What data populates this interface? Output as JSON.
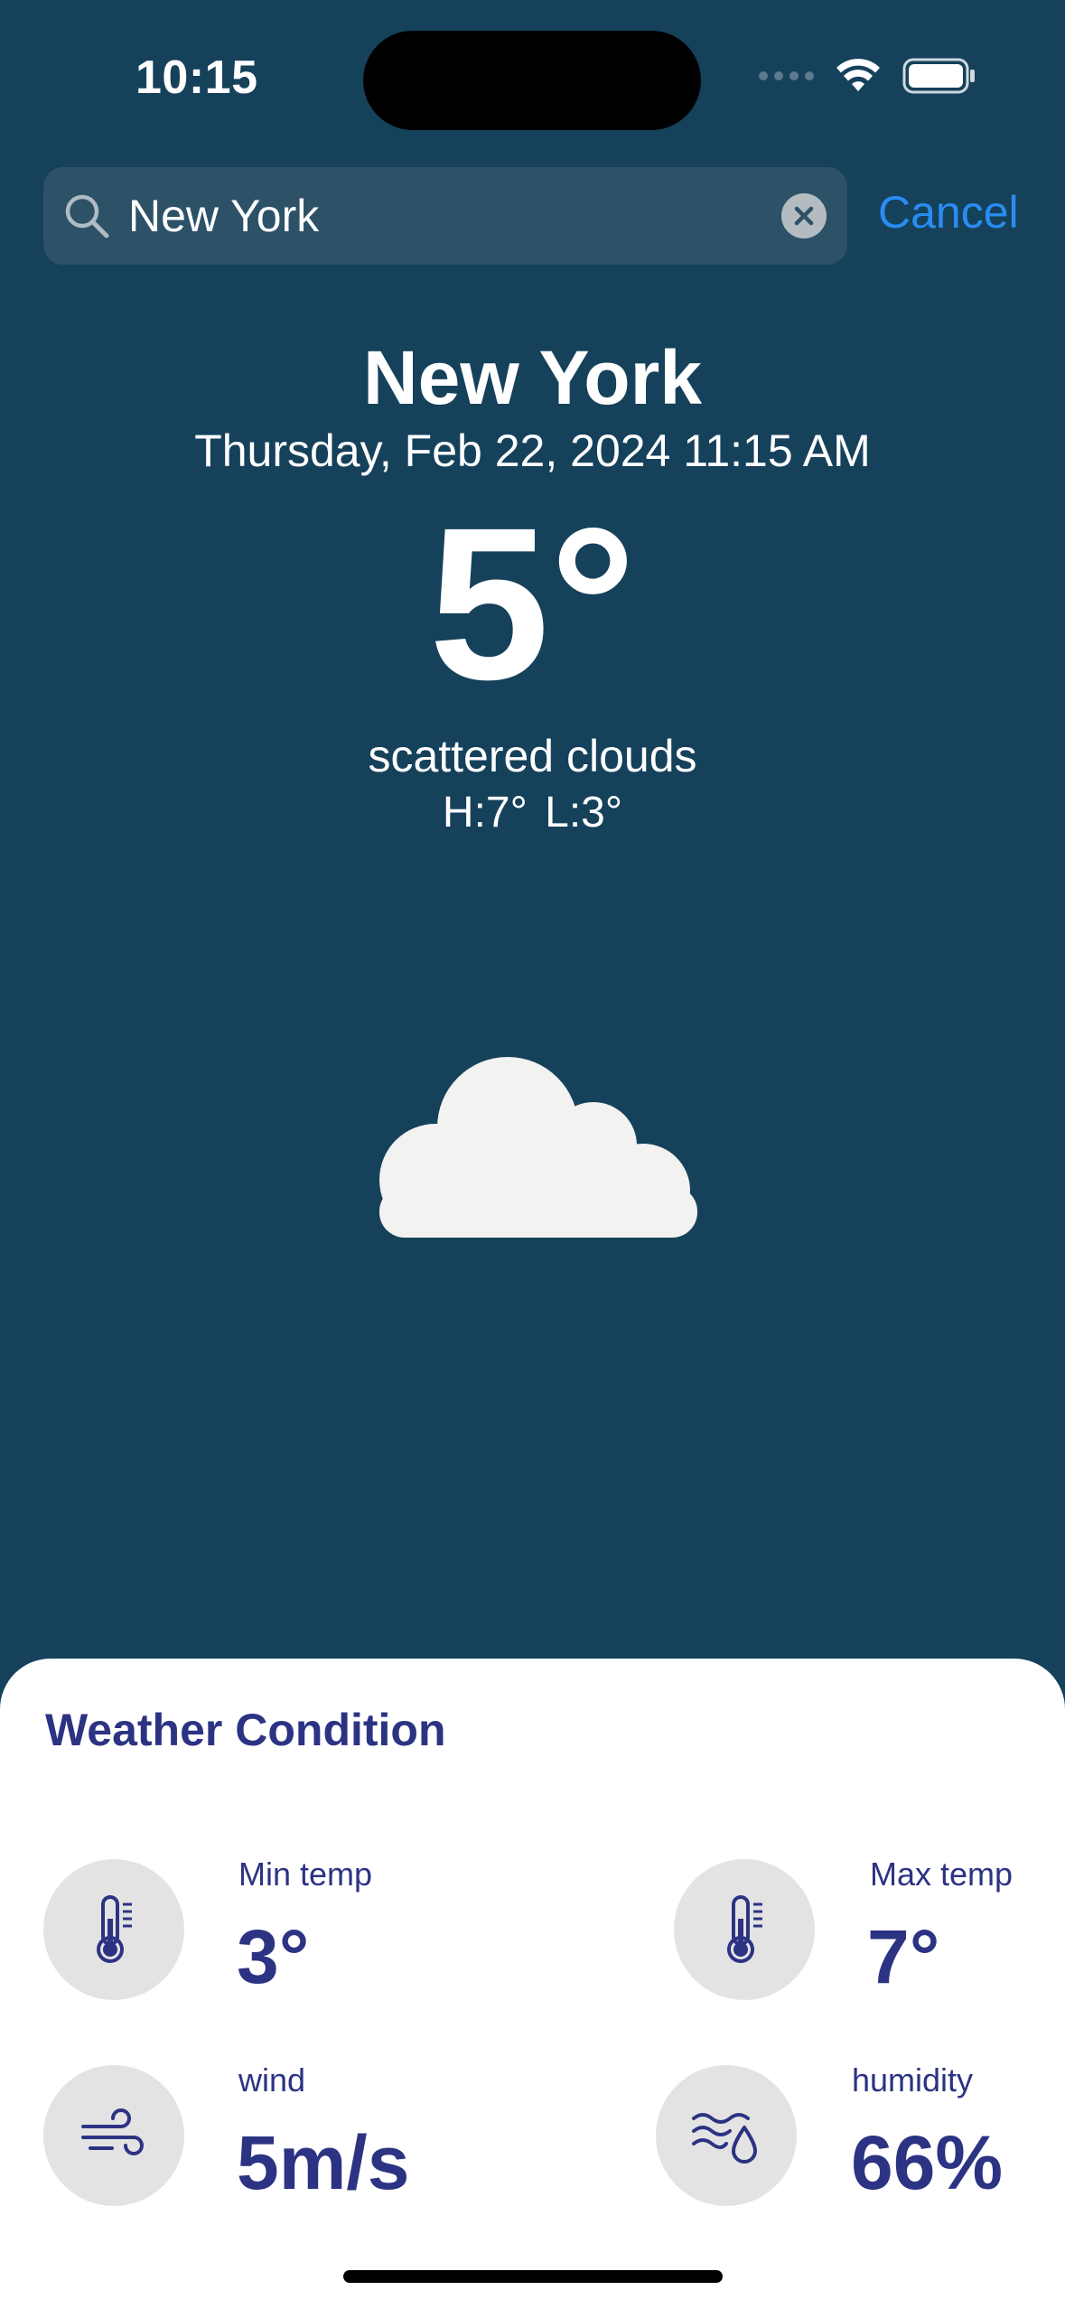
{
  "status_bar": {
    "time": "10:15"
  },
  "search": {
    "value": "New York",
    "cancel_label": "Cancel"
  },
  "weather": {
    "city": "New York",
    "datetime": "Thursday, Feb 22, 2024 11:15 AM",
    "temperature": "5°",
    "condition": "scattered clouds",
    "high_low": "H:7°  L:3°",
    "icon": "cloud-icon"
  },
  "details": {
    "title": "Weather Condition",
    "metrics": [
      {
        "label": "Min temp",
        "value": "3°",
        "icon": "thermometer-icon"
      },
      {
        "label": "Max temp",
        "value": "7°",
        "icon": "thermometer-icon"
      },
      {
        "label": "wind",
        "value": "5m/s",
        "icon": "wind-icon"
      },
      {
        "label": "humidity",
        "value": "66%",
        "icon": "humidity-icon"
      }
    ]
  },
  "colors": {
    "background": "#15415b",
    "search_field": "#2d5167",
    "accent": "#2a8cf3",
    "sheet_text": "#2c3383",
    "icon_circle": "#e3e3e3"
  }
}
